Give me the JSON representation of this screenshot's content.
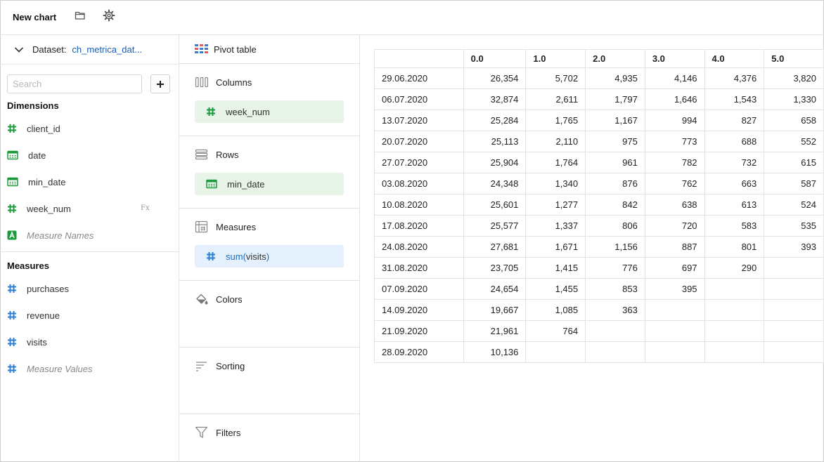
{
  "header": {
    "title": "New chart",
    "icons": [
      "folder-icon",
      "gear-icon"
    ]
  },
  "dataset": {
    "label": "Dataset:",
    "value": "ch_metrica_dat..."
  },
  "search": {
    "placeholder": "Search",
    "value": ""
  },
  "dimensions": {
    "title": "Dimensions",
    "items": [
      {
        "label": "client_id",
        "icon": "hash-icon",
        "color": "#1a9b3b"
      },
      {
        "label": "date",
        "icon": "calendar-icon",
        "color": "#1a9b3b"
      },
      {
        "label": "min_date",
        "icon": "calendar-icon",
        "color": "#1a9b3b"
      },
      {
        "label": "week_num",
        "icon": "hash-icon",
        "color": "#1a9b3b",
        "badge": "Fx"
      },
      {
        "label": "Measure Names",
        "icon": "text-a-icon",
        "color": "#1a9b3b"
      }
    ]
  },
  "measures": {
    "title": "Measures",
    "items": [
      {
        "label": "purchases",
        "icon": "hash-icon",
        "color": "#2b7fd4"
      },
      {
        "label": "revenue",
        "icon": "hash-icon",
        "color": "#2b7fd4"
      },
      {
        "label": "visits",
        "icon": "hash-icon",
        "color": "#2b7fd4"
      },
      {
        "label": "Measure Values",
        "icon": "hash-icon",
        "color": "#2b7fd4"
      }
    ]
  },
  "visualization": {
    "label": "Pivot table"
  },
  "sections": {
    "columns": {
      "title": "Columns",
      "chip": "week_num"
    },
    "rows": {
      "title": "Rows",
      "chip": "min_date"
    },
    "measures": {
      "title": "Measures",
      "chip_func": "sum",
      "chip_arg_open": "(",
      "chip_arg": "visits",
      "chip_arg_close": ")"
    },
    "colors": {
      "title": "Colors"
    },
    "sorting": {
      "title": "Sorting"
    },
    "filters": {
      "title": "Filters"
    }
  },
  "pivot": {
    "columns": [
      "",
      "0.0",
      "1.0",
      "2.0",
      "3.0",
      "4.0",
      "5.0"
    ],
    "rows": [
      [
        "29.06.2020",
        "26,354",
        "5,702",
        "4,935",
        "4,146",
        "4,376",
        "3,820"
      ],
      [
        "06.07.2020",
        "32,874",
        "2,611",
        "1,797",
        "1,646",
        "1,543",
        "1,330"
      ],
      [
        "13.07.2020",
        "25,284",
        "1,765",
        "1,167",
        "994",
        "827",
        "658"
      ],
      [
        "20.07.2020",
        "25,113",
        "2,110",
        "975",
        "773",
        "688",
        "552"
      ],
      [
        "27.07.2020",
        "25,904",
        "1,764",
        "961",
        "782",
        "732",
        "615"
      ],
      [
        "03.08.2020",
        "24,348",
        "1,340",
        "876",
        "762",
        "663",
        "587"
      ],
      [
        "10.08.2020",
        "25,601",
        "1,277",
        "842",
        "638",
        "613",
        "524"
      ],
      [
        "17.08.2020",
        "25,577",
        "1,337",
        "806",
        "720",
        "583",
        "535"
      ],
      [
        "24.08.2020",
        "27,681",
        "1,671",
        "1,156",
        "887",
        "801",
        "393"
      ],
      [
        "31.08.2020",
        "23,705",
        "1,415",
        "776",
        "697",
        "290",
        ""
      ],
      [
        "07.09.2020",
        "24,654",
        "1,455",
        "853",
        "395",
        "",
        ""
      ],
      [
        "14.09.2020",
        "19,667",
        "1,085",
        "363",
        "",
        "",
        ""
      ],
      [
        "21.09.2020",
        "21,961",
        "764",
        "",
        "",
        "",
        ""
      ],
      [
        "28.09.2020",
        "10,136",
        "",
        "",
        "",
        "",
        ""
      ]
    ]
  }
}
